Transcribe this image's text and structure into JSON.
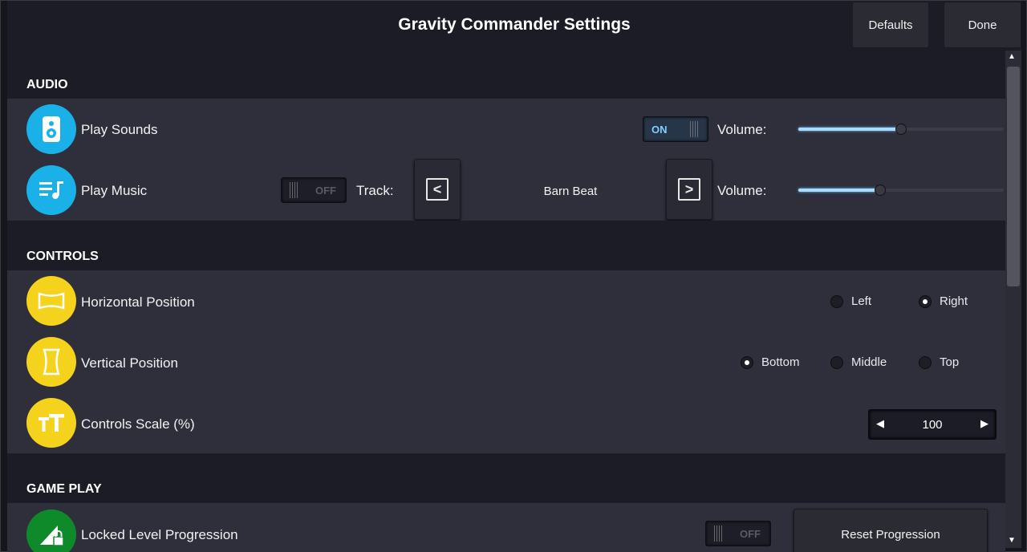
{
  "window": {
    "title": "Gravity Commander Settings"
  },
  "header": {
    "defaults_label": "Defaults",
    "done_label": "Done"
  },
  "audio": {
    "heading": "AUDIO",
    "play_sounds": {
      "label": "Play Sounds",
      "toggle": "ON",
      "volume_label": "Volume:",
      "volume": 0.5
    },
    "play_music": {
      "label": "Play Music",
      "toggle": "OFF",
      "track_label": "Track:",
      "track_name": "Barn Beat",
      "prev_glyph": "<",
      "next_glyph": ">",
      "volume_label": "Volume:",
      "volume": 0.4
    }
  },
  "controls": {
    "heading": "CONTROLS",
    "horizontal": {
      "label": "Horizontal Position",
      "options": [
        "Left",
        "Right"
      ],
      "selected": "Right"
    },
    "vertical": {
      "label": "Vertical Position",
      "options": [
        "Bottom",
        "Middle",
        "Top"
      ],
      "selected": "Bottom"
    },
    "scale": {
      "label": "Controls Scale (%)",
      "value": "100"
    }
  },
  "gameplay": {
    "heading": "GAME PLAY",
    "locked": {
      "label": "Locked Level Progression",
      "toggle": "OFF",
      "reset_label": "Reset Progression"
    }
  },
  "colors": {
    "audio_icon": "#1ab0e8",
    "controls_icon": "#f5d21c",
    "gameplay_icon": "#0f8a2a",
    "slider_fill": "#a8dcff"
  },
  "icons": {
    "play_sounds": "speaker-icon",
    "play_music": "music-list-icon",
    "horizontal": "horizontal-frame-icon",
    "vertical": "vertical-frame-icon",
    "scale": "text-size-icon",
    "locked": "lock-progress-icon"
  }
}
